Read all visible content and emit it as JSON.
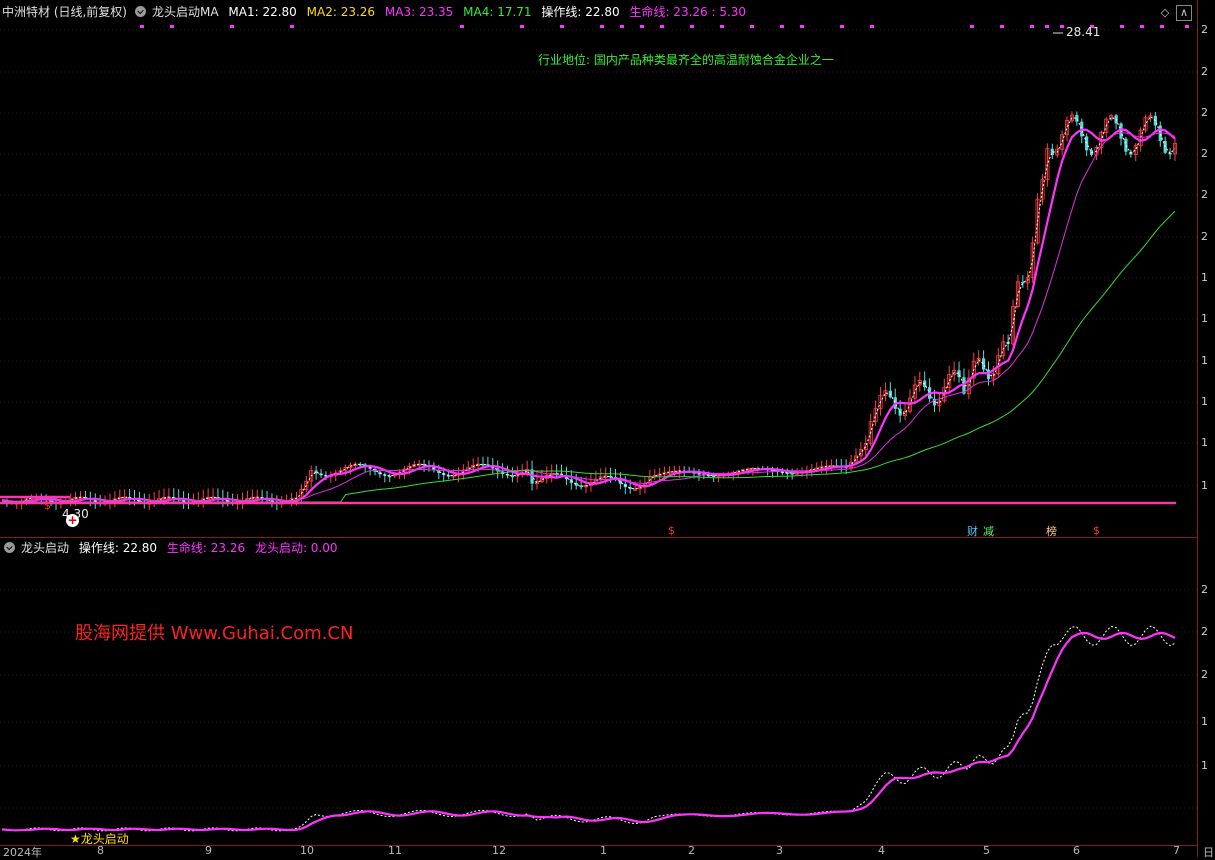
{
  "main_header": {
    "stock": "中洲特材 (日线,前复权)",
    "indicator": "龙头启动MA",
    "ma1": "MA1: 22.80",
    "ma2": "MA2: 23.26",
    "ma3": "MA3: 23.35",
    "ma4": "MA4: 17.71",
    "op_line": "操作线: 22.80",
    "life_line": "生命线: 23.26 : 5.30"
  },
  "industry_note": "行业地位: 国内产品种类最齐全的高温耐蚀合金企业之一",
  "high_label": "28.41",
  "low_label": "4.30",
  "event_marks": {
    "fin": "财",
    "reduce": "减",
    "rank": "榜",
    "dollar": "$"
  },
  "sub_header": {
    "indicator": "龙头启动",
    "op_line": "操作线: 22.80",
    "life_line": "生命线: 23.26",
    "start": "龙头启动: 0.00"
  },
  "watermark": "股海网提供 Www.Guhai.Com.CN",
  "signal_label": "龙头启动",
  "x_labels": [
    "2024年",
    "8",
    "9",
    "10",
    "11",
    "12",
    "1",
    "2",
    "3",
    "4",
    "5",
    "6",
    "7"
  ],
  "y_tick_chars": [
    "2",
    "2",
    "2",
    "2",
    "2",
    "2",
    "1",
    "1",
    "1",
    "1",
    "1",
    "1",
    "2",
    "2",
    "2",
    "1",
    "1"
  ],
  "right_edge_label": "日",
  "colors": {
    "ma1": "#ffffff",
    "ma2": "#ff33ff",
    "ma3": "#dd33dd",
    "ma4": "#33dd33",
    "up": "#ff4040",
    "down": "#55dddd",
    "accent": "#ff33ff"
  }
}
